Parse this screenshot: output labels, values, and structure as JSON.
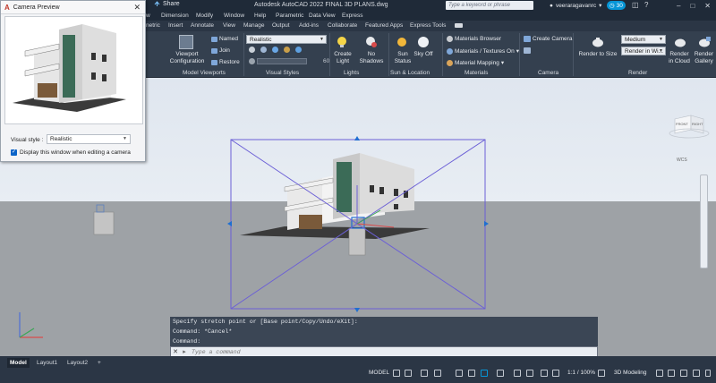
{
  "titlebar": {
    "share": "Share",
    "title": "Autodesk AutoCAD 2022   FINAL 3D PLANS.dwg",
    "search_placeholder": "Type a keyword or phrase",
    "user": "veeraragavanrc",
    "badge_count": "30"
  },
  "menubar": [
    "w",
    "Dimension",
    "Modify",
    "Window",
    "Help",
    "Parametric",
    "Data View",
    "Express"
  ],
  "ribbon_tabs": [
    "netric",
    "Insert",
    "Annotate",
    "View",
    "Manage",
    "Output",
    "Add-ins",
    "Collaborate",
    "Featured Apps",
    "Express Tools"
  ],
  "ribbon": {
    "viewport_config": "Viewport Configuration",
    "named": "Named",
    "join": "Join",
    "restore": "Restore",
    "visual_style_value": "Realistic",
    "opacity_value": "60",
    "create_light": "Create Light",
    "no_shadows": "No Shadows",
    "sun_status": "Sun Status",
    "sky_off": "Sky Off",
    "materials_browser": "Materials Browser",
    "materials_textures_on": "Materials / Textures On",
    "material_mapping": "Material Mapping",
    "create_camera": "Create Camera",
    "render_to_size": "Render to Size",
    "render_quality": "Medium",
    "render_in": "Render in Wi...",
    "render_in_cloud": "Render in Cloud",
    "render_gallery": "Render Gallery",
    "panels": {
      "model_viewports": "Model Viewports",
      "visual_styles": "Visual Styles",
      "lights": "Lights",
      "sun_location": "Sun & Location",
      "materials": "Materials",
      "camera": "Camera",
      "render": "Render"
    }
  },
  "viewcube": {
    "front": "FRONT",
    "right": "RIGHT",
    "wcs": "WCS"
  },
  "camera_preview": {
    "title": "Camera Preview",
    "visual_style_label": "Visual style :",
    "visual_style_value": "Realistic",
    "checkbox_label": "Display this window when editing a camera",
    "checkbox_checked": true
  },
  "command": {
    "history": [
      "Specify stretch point or [Base point/Copy/Undo/eXit]:",
      "Command: *Cancel*",
      "Command:"
    ],
    "placeholder": "Type a command"
  },
  "layout_tabs": [
    "Model",
    "Layout1",
    "Layout2",
    "+"
  ],
  "status": {
    "model": "MODEL",
    "scale": "1:1 / 100%",
    "workspace": "3D Modeling"
  },
  "colors": {
    "accent": "#0696d7",
    "frustum": "#6b5fd6",
    "ribbon": "#34404f"
  }
}
